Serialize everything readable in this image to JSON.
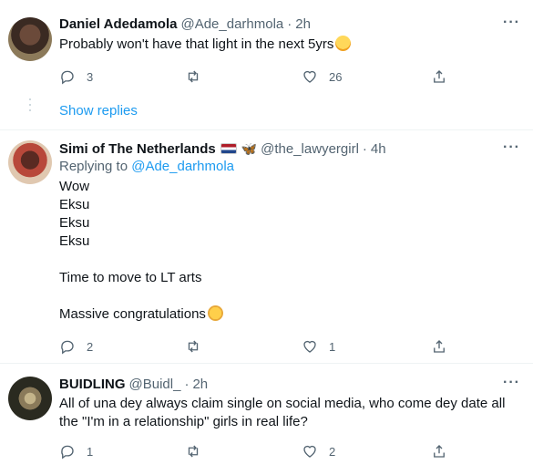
{
  "tweets": [
    {
      "name": "Daniel Adedamola",
      "handle": "@Ade_darhmola",
      "time": "2h",
      "text": "Probably won't have that light in the next 5yrs",
      "emoji": "loudly-crying-face-emoji",
      "replies": "3",
      "retweets": "",
      "likes": "26"
    },
    {
      "name": "Simi of The Netherlands",
      "handle": "@the_lawyergirl",
      "time": "4h",
      "replying_prefix": "Replying to",
      "replying_to": "@Ade_darhmola",
      "lines": [
        "Wow",
        "Eksu",
        "Eksu",
        "Eksu",
        "",
        "Time to move to LT arts",
        "",
        "Massive congratulations"
      ],
      "flag": "netherlands-flag-emoji",
      "badge": "butterfly-emoji",
      "replies": "2",
      "retweets": "",
      "likes": "1"
    },
    {
      "name": "BUIDLING",
      "handle": "@Buidl_",
      "time": "2h",
      "text": "All of una dey always claim single on social media, who come dey date all the \"I'm in a relationship\" girls in real life?",
      "replies": "1",
      "retweets": "",
      "likes": "2"
    }
  ],
  "show_replies": "Show replies",
  "more_label": "···",
  "dot_separator": "·"
}
